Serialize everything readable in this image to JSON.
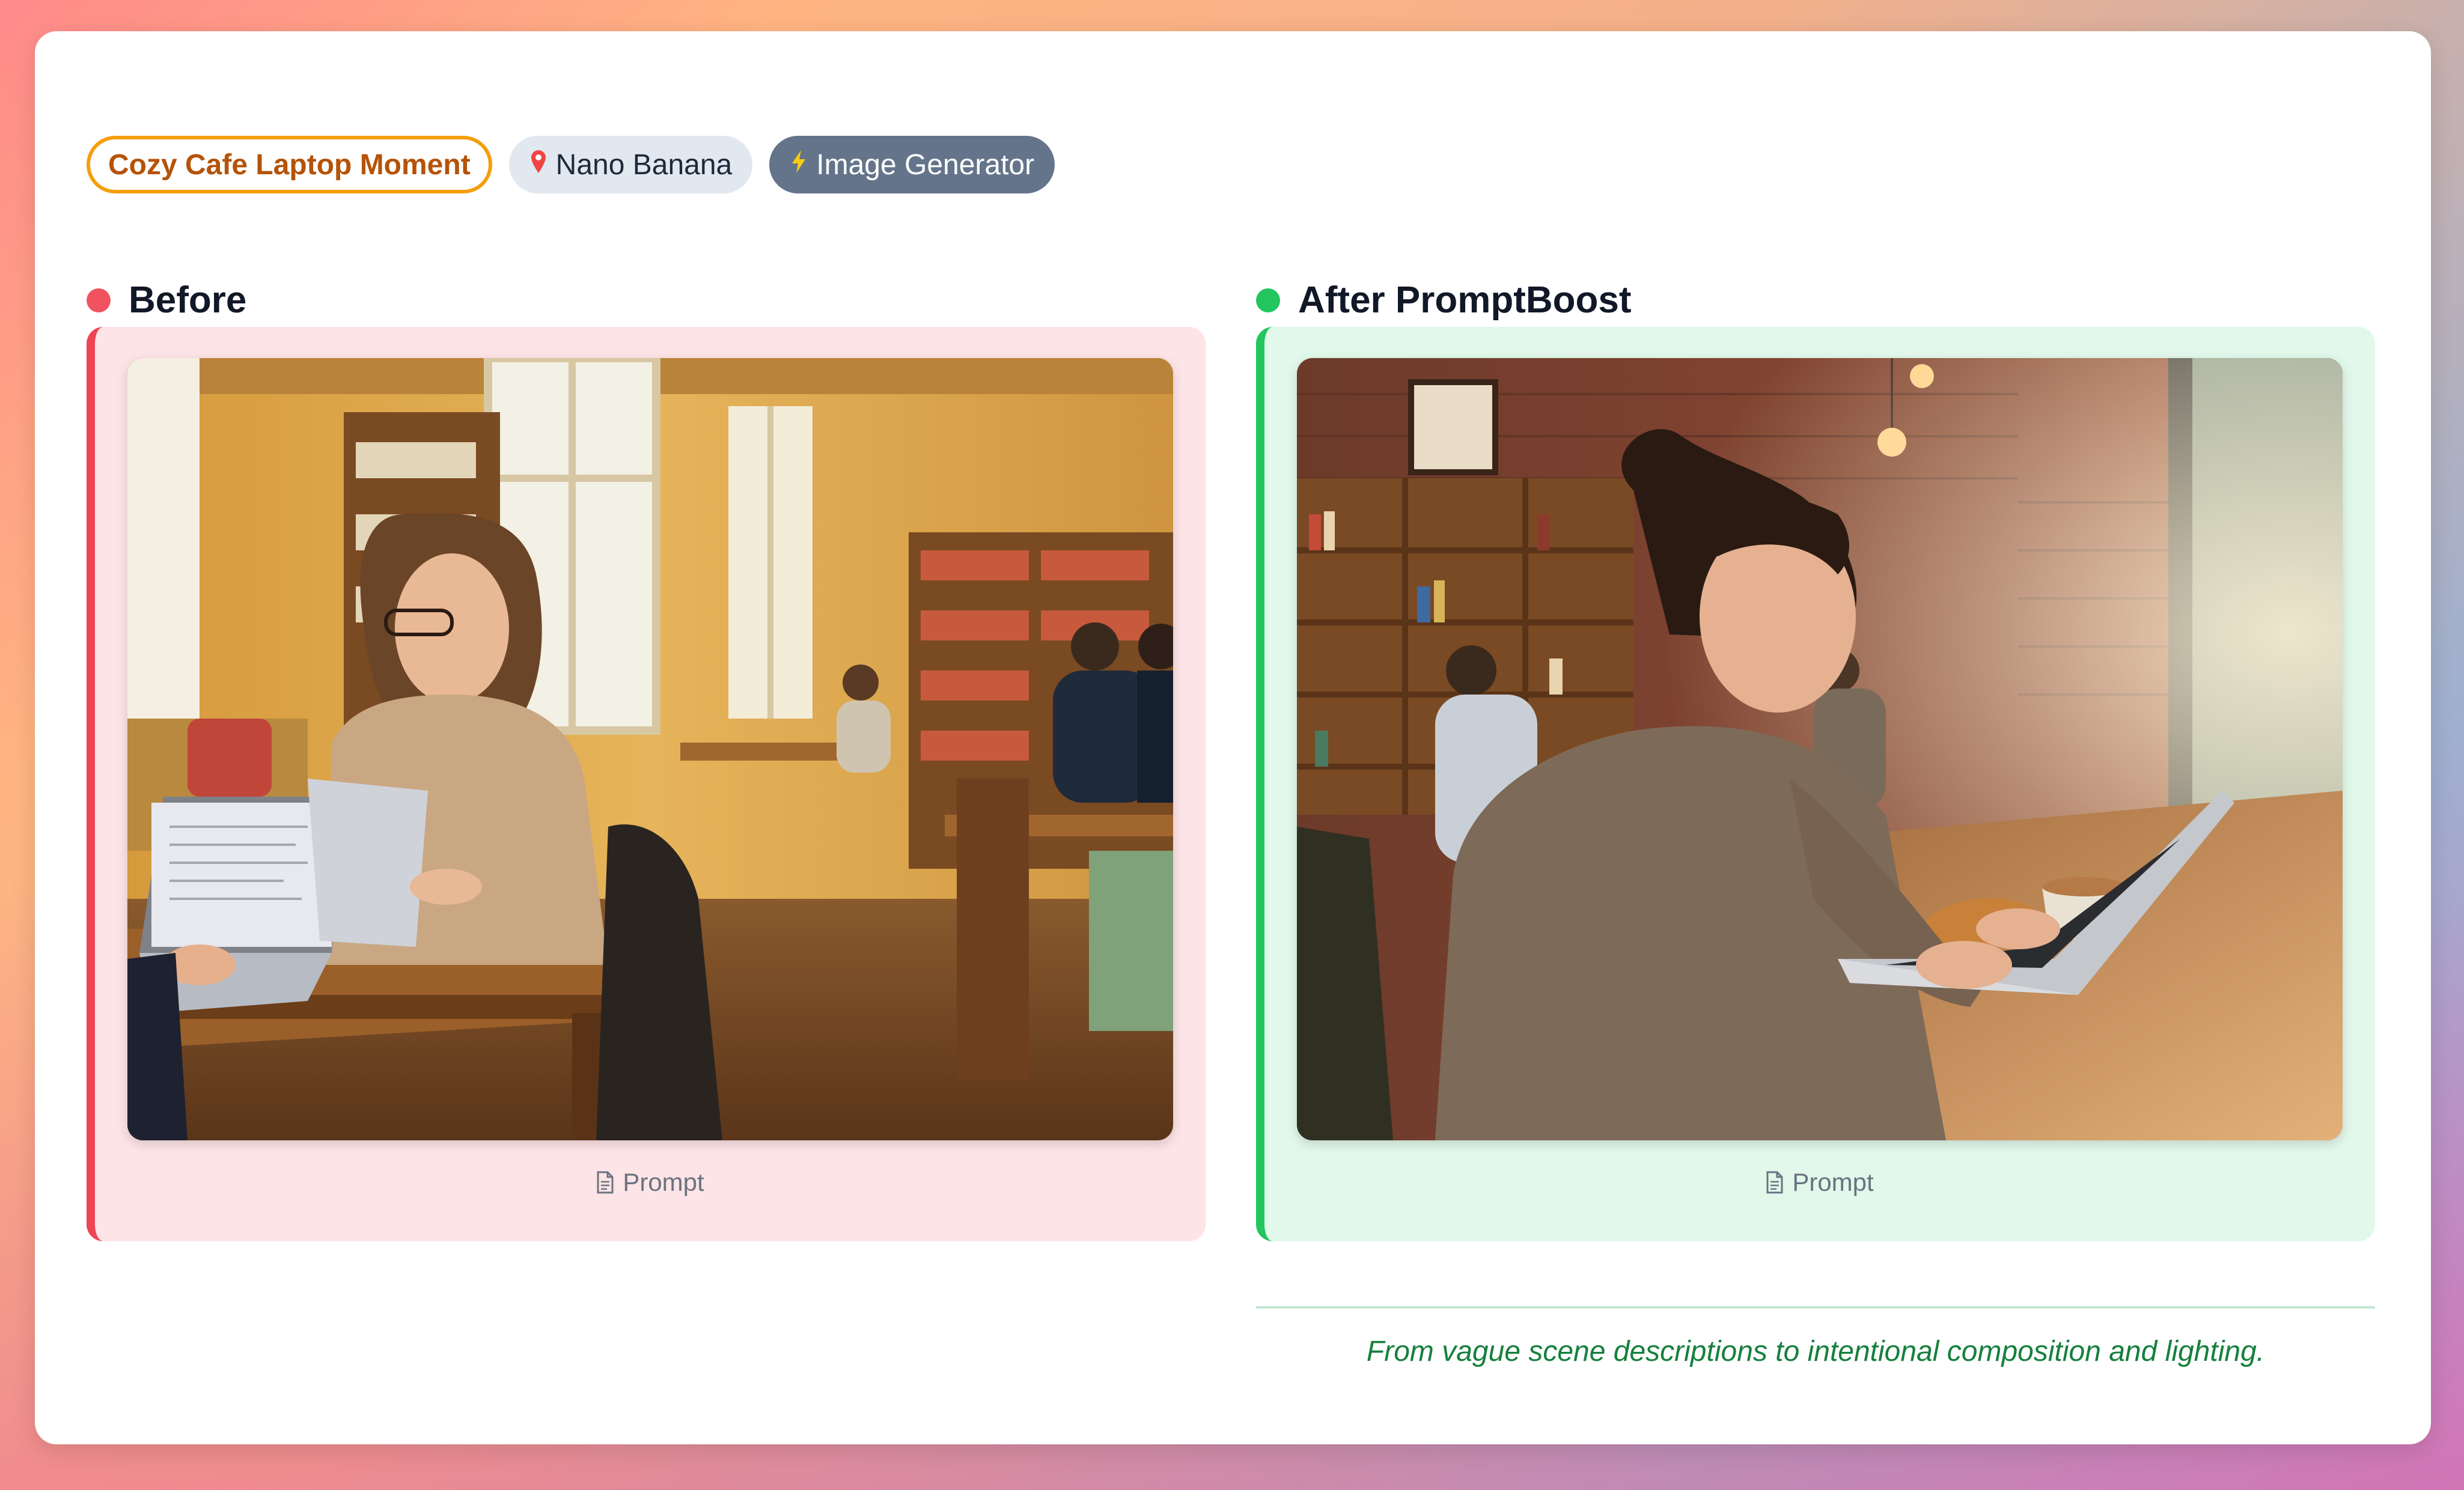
{
  "tags": {
    "title": "Cozy Cafe Laptop Moment",
    "model": "Nano Banana",
    "model_icon": "pin-icon",
    "type": "Image Generator",
    "type_icon": "lightning-icon"
  },
  "before": {
    "heading": "Before",
    "dot_color": "#f0525f",
    "prompt_label": "Prompt"
  },
  "after": {
    "heading": "After PromptBoost",
    "dot_color": "#22c55e",
    "prompt_label": "Prompt"
  },
  "caption": "From vague scene descriptions to intentional composition and lighting.",
  "colors": {
    "before_accent": "#ef4455",
    "after_accent": "#22c55e",
    "title_tag": "#f59e0b",
    "caption": "#15803d"
  }
}
